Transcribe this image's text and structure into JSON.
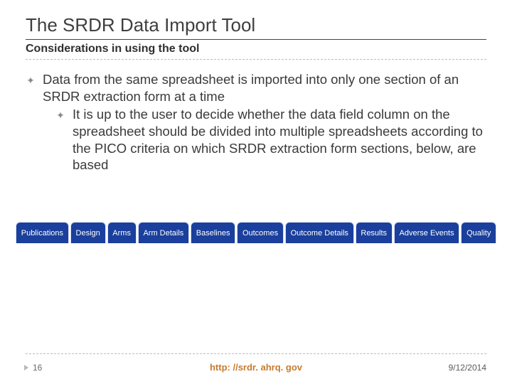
{
  "title": "The SRDR Data Import Tool",
  "subtitle": "Considerations in using the tool",
  "bullets": {
    "lvl1": "Data from the same spreadsheet is imported into only one section of an SRDR extraction form at a time",
    "lvl2": "It is up to the user to decide whether the data field column on the spreadsheet should be divided into multiple spreadsheets according to the PICO criteria on which SRDR extraction form sections, below, are based"
  },
  "tabs": [
    "Publications",
    "Design",
    "Arms",
    "Arm Details",
    "Baselines",
    "Outcomes",
    "Outcome Details",
    "Results",
    "Adverse Events",
    "Quality"
  ],
  "footer": {
    "page": "16",
    "url": "http: //srdr. ahrq. gov",
    "date": "9/12/2014"
  }
}
